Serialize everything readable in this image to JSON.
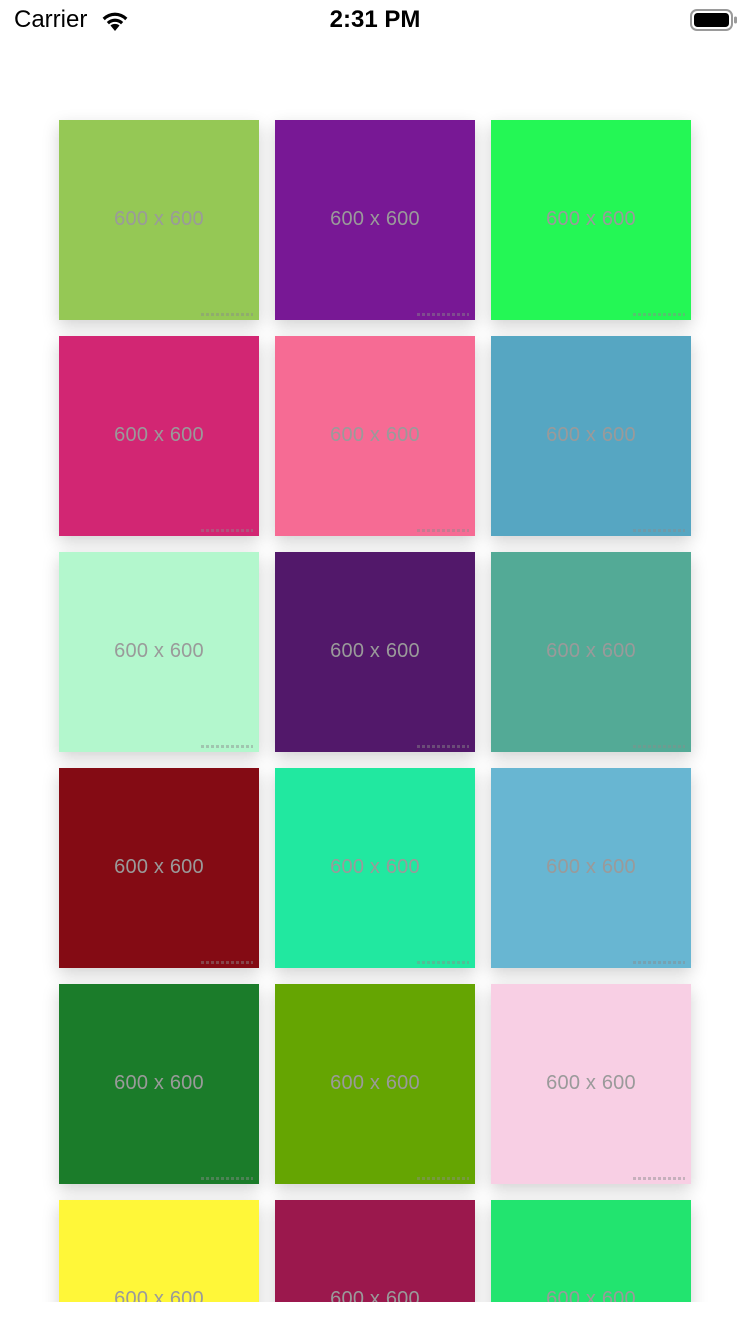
{
  "status_bar": {
    "carrier": "Carrier",
    "time": "2:31 PM"
  },
  "icons": {
    "wifi": "wifi-icon",
    "battery": "battery-icon"
  },
  "tiles": [
    {
      "color": "#95c855",
      "label": "600 x 600"
    },
    {
      "color": "#781895",
      "label": "600 x 600"
    },
    {
      "color": "#24f755",
      "label": "600 x 600"
    },
    {
      "color": "#d22673",
      "label": "600 x 600"
    },
    {
      "color": "#f66b94",
      "label": "600 x 600"
    },
    {
      "color": "#56a6c2",
      "label": "600 x 600"
    },
    {
      "color": "#b3f7cd",
      "label": "600 x 600"
    },
    {
      "color": "#52186a",
      "label": "600 x 600"
    },
    {
      "color": "#53aa96",
      "label": "600 x 600"
    },
    {
      "color": "#840b14",
      "label": "600 x 600"
    },
    {
      "color": "#21e8a0",
      "label": "600 x 600"
    },
    {
      "color": "#68b6d2",
      "label": "600 x 600"
    },
    {
      "color": "#1b7c2a",
      "label": "600 x 600"
    },
    {
      "color": "#65a502",
      "label": "600 x 600"
    },
    {
      "color": "#f8cfe4",
      "label": "600 x 600"
    },
    {
      "color": "#fff739",
      "label": "600 x 600"
    },
    {
      "color": "#9b184d",
      "label": "600 x 600"
    },
    {
      "color": "#22e46f",
      "label": "600 x 600"
    }
  ]
}
